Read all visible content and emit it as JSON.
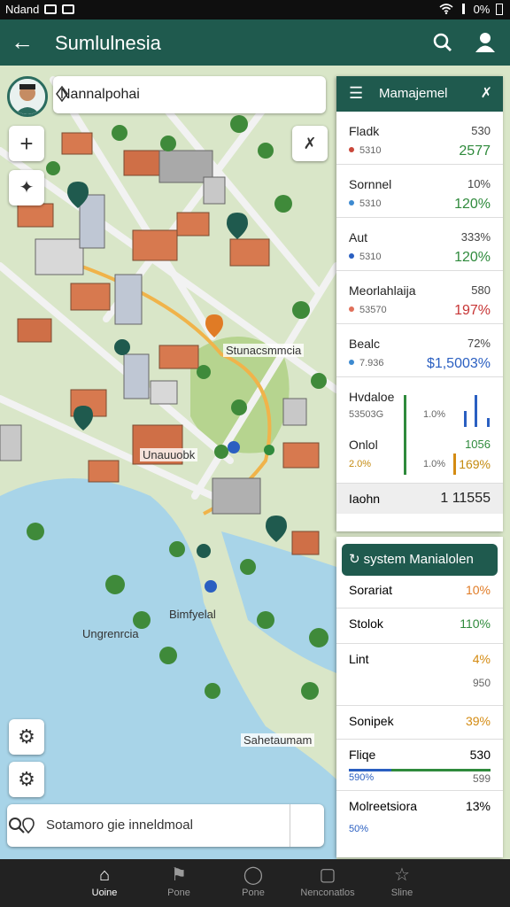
{
  "status_bar": {
    "left_text": "Ndand",
    "right_text": "0%"
  },
  "app_bar": {
    "title": "Sumlulnesia"
  },
  "map": {
    "location_card": "Nannalpohai",
    "labels": {
      "plaza": "Stunacsmmcia",
      "center": "Unauuobk",
      "bay": "Bimfyelal",
      "water": "Ungrenrcia",
      "pier": "Sahetaumam"
    },
    "search_text": "Sotamoro gie inneldmoal"
  },
  "side_panel": {
    "header": "Mamajemel",
    "rows": [
      {
        "name": "Fladk",
        "value": "530",
        "sub": "5310",
        "pct": "2577",
        "dot": "#c9473a",
        "pct_color": "#2f8a3c"
      },
      {
        "name": "Sornnel",
        "value": "10%",
        "sub": "5310",
        "pct": "120%",
        "dot": "#3d8ad0",
        "pct_color": "#2f8a3c"
      },
      {
        "name": "Aut",
        "value": "333%",
        "sub": "5310",
        "pct": "120%",
        "dot": "#2a5fc1",
        "pct_color": "#2f8a3c"
      },
      {
        "name": "Meorlahlaija",
        "value": "580",
        "sub": "53570",
        "pct": "197%",
        "dot": "#e0705a",
        "pct_color": "#c73535"
      },
      {
        "name": "Bealc",
        "value": "72%",
        "sub": "7.936",
        "pct": "$1,5003%",
        "dot": "#3d8ad0",
        "pct_color": "#2a5fc1"
      }
    ],
    "chart_block": {
      "title1": "Hvdaloe",
      "sub1": "53503G",
      "v1": "1.0%",
      "title2": "Onlol",
      "v2": "1056",
      "sub2": "2.0%",
      "v3": "1.0%",
      "v4": "169%"
    },
    "footer": {
      "label": "Iaohn",
      "value": "1 11555"
    }
  },
  "system_panel": {
    "button": "system Manialolen",
    "rows": [
      {
        "name": "Sorariat",
        "value": "10%",
        "color": "#e07b25"
      },
      {
        "name": "Stolok",
        "value": "110%",
        "color": "#2f8a3c"
      },
      {
        "name": "Lint",
        "value": "4%",
        "sub": "950",
        "color": "#d48b12"
      },
      {
        "name": "Sonipek",
        "value": "39%",
        "color": "#d48b12"
      },
      {
        "name": "Fliqe",
        "value": "530",
        "sub": "599",
        "sub_left": "590%"
      },
      {
        "name": "Molreetsiora",
        "value": "13%",
        "sub_left": "50%"
      }
    ]
  },
  "bottom_nav": [
    {
      "label": "Uoine",
      "icon": "home-icon",
      "active": true
    },
    {
      "label": "Pone",
      "icon": "flag-icon",
      "active": false
    },
    {
      "label": "Pone",
      "icon": "circle-icon",
      "active": false
    },
    {
      "label": "Nenconatlos",
      "icon": "calendar-icon",
      "active": false
    },
    {
      "label": "Sline",
      "icon": "star-icon",
      "active": false
    }
  ],
  "colors": {
    "primary": "#1f5a4e",
    "water": "#a8d4e8",
    "land": "#d9e6c8"
  }
}
